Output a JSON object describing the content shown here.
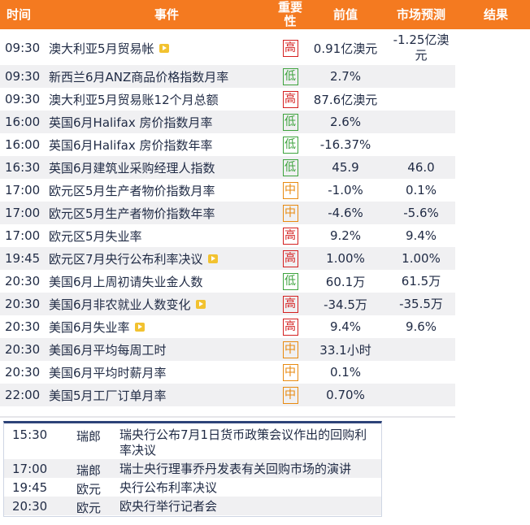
{
  "header": {
    "time": "时间",
    "event": "事件",
    "importance": "重要性",
    "previous": "前值",
    "forecast": "市场预测",
    "result": "结果"
  },
  "importance_colors": {
    "高": "#d42020",
    "中": "#e88a10",
    "低": "#3ea33e"
  },
  "events": [
    {
      "time": "09:30",
      "event": "澳大利亚5月贸易帐",
      "video": true,
      "importance": "高",
      "previous": "0.91亿澳元",
      "forecast": "-1.25亿澳元"
    },
    {
      "time": "09:30",
      "event": "新西兰6月ANZ商品价格指数月率",
      "video": false,
      "importance": "低",
      "previous": "2.7%",
      "forecast": ""
    },
    {
      "time": "09:30",
      "event": "澳大利亚5月贸易账12个月总额",
      "video": false,
      "importance": "高",
      "previous": "87.6亿澳元",
      "forecast": ""
    },
    {
      "time": "16:00",
      "event": "英国6月Halifax 房价指数月率",
      "video": false,
      "importance": "低",
      "previous": "2.6%",
      "forecast": ""
    },
    {
      "time": "16:00",
      "event": "英国6月Halifax 房价指数年率",
      "video": false,
      "importance": "低",
      "previous": "-16.37%",
      "forecast": ""
    },
    {
      "time": "16:30",
      "event": "英国6月建筑业采购经理人指数",
      "video": false,
      "importance": "低",
      "previous": "45.9",
      "forecast": "46.0"
    },
    {
      "time": "17:00",
      "event": "欧元区5月生产者物价指数月率",
      "video": false,
      "importance": "中",
      "previous": "-1.0%",
      "forecast": "0.1%"
    },
    {
      "time": "17:00",
      "event": "欧元区5月生产者物价指数年率",
      "video": false,
      "importance": "中",
      "previous": "-4.6%",
      "forecast": "-5.6%"
    },
    {
      "time": "17:00",
      "event": "欧元区5月失业率",
      "video": false,
      "importance": "高",
      "previous": "9.2%",
      "forecast": "9.4%"
    },
    {
      "time": "19:45",
      "event": "欧元区7月央行公布利率决议",
      "video": true,
      "importance": "高",
      "previous": "1.00%",
      "forecast": "1.00%"
    },
    {
      "time": "20:30",
      "event": "美国6月上周初请失业金人数",
      "video": false,
      "importance": "低",
      "previous": "60.1万",
      "forecast": "61.5万"
    },
    {
      "time": "20:30",
      "event": "美国6月非农就业人数变化",
      "video": true,
      "importance": "高",
      "previous": "-34.5万",
      "forecast": "-35.5万"
    },
    {
      "time": "20:30",
      "event": "美国6月失业率",
      "video": true,
      "importance": "高",
      "previous": "9.4%",
      "forecast": "9.6%"
    },
    {
      "time": "20:30",
      "event": "美国6月平均每周工时",
      "video": false,
      "importance": "中",
      "previous": "33.1小时",
      "forecast": ""
    },
    {
      "time": "20:30",
      "event": "美国6月平均时薪月率",
      "video": false,
      "importance": "中",
      "previous": "0.1%",
      "forecast": ""
    },
    {
      "time": "22:00",
      "event": "美国5月工厂订单月率",
      "video": false,
      "importance": "中",
      "previous": "0.70%",
      "forecast": ""
    }
  ],
  "other_events": [
    {
      "time": "15:30",
      "currency": "瑞郎",
      "desc": "瑞央行公布7月1日货币政策会议作出的回购利率决议"
    },
    {
      "time": "17:00",
      "currency": "瑞郎",
      "desc": "瑞士央行理事乔丹发表有关回购市场的演讲"
    },
    {
      "time": "19:45",
      "currency": "欧元",
      "desc": "央行公布利率决议"
    },
    {
      "time": "20:30",
      "currency": "欧元",
      "desc": "欧央行举行记者会"
    }
  ]
}
